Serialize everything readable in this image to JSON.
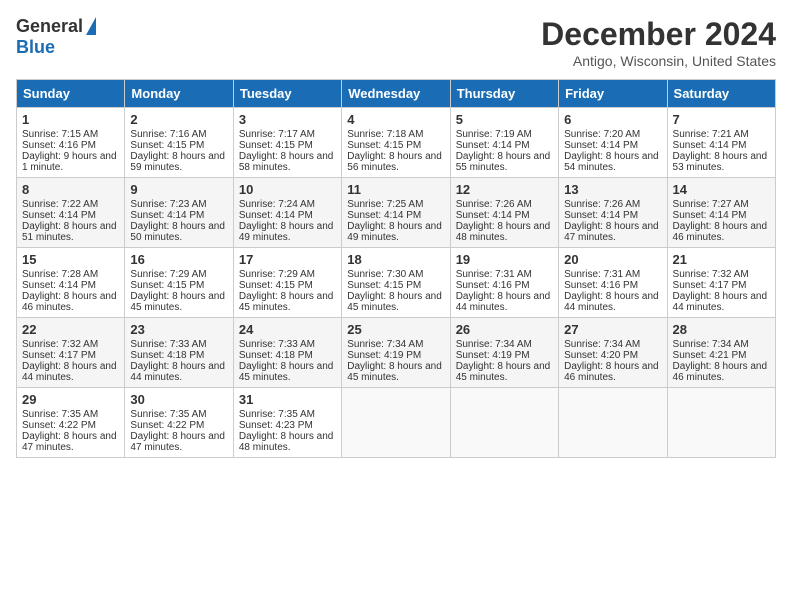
{
  "header": {
    "logo_general": "General",
    "logo_blue": "Blue",
    "month_title": "December 2024",
    "location": "Antigo, Wisconsin, United States"
  },
  "weekdays": [
    "Sunday",
    "Monday",
    "Tuesday",
    "Wednesday",
    "Thursday",
    "Friday",
    "Saturday"
  ],
  "weeks": [
    [
      {
        "day": "1",
        "sunrise": "Sunrise: 7:15 AM",
        "sunset": "Sunset: 4:16 PM",
        "daylight": "Daylight: 9 hours and 1 minute."
      },
      {
        "day": "2",
        "sunrise": "Sunrise: 7:16 AM",
        "sunset": "Sunset: 4:15 PM",
        "daylight": "Daylight: 8 hours and 59 minutes."
      },
      {
        "day": "3",
        "sunrise": "Sunrise: 7:17 AM",
        "sunset": "Sunset: 4:15 PM",
        "daylight": "Daylight: 8 hours and 58 minutes."
      },
      {
        "day": "4",
        "sunrise": "Sunrise: 7:18 AM",
        "sunset": "Sunset: 4:15 PM",
        "daylight": "Daylight: 8 hours and 56 minutes."
      },
      {
        "day": "5",
        "sunrise": "Sunrise: 7:19 AM",
        "sunset": "Sunset: 4:14 PM",
        "daylight": "Daylight: 8 hours and 55 minutes."
      },
      {
        "day": "6",
        "sunrise": "Sunrise: 7:20 AM",
        "sunset": "Sunset: 4:14 PM",
        "daylight": "Daylight: 8 hours and 54 minutes."
      },
      {
        "day": "7",
        "sunrise": "Sunrise: 7:21 AM",
        "sunset": "Sunset: 4:14 PM",
        "daylight": "Daylight: 8 hours and 53 minutes."
      }
    ],
    [
      {
        "day": "8",
        "sunrise": "Sunrise: 7:22 AM",
        "sunset": "Sunset: 4:14 PM",
        "daylight": "Daylight: 8 hours and 51 minutes."
      },
      {
        "day": "9",
        "sunrise": "Sunrise: 7:23 AM",
        "sunset": "Sunset: 4:14 PM",
        "daylight": "Daylight: 8 hours and 50 minutes."
      },
      {
        "day": "10",
        "sunrise": "Sunrise: 7:24 AM",
        "sunset": "Sunset: 4:14 PM",
        "daylight": "Daylight: 8 hours and 49 minutes."
      },
      {
        "day": "11",
        "sunrise": "Sunrise: 7:25 AM",
        "sunset": "Sunset: 4:14 PM",
        "daylight": "Daylight: 8 hours and 49 minutes."
      },
      {
        "day": "12",
        "sunrise": "Sunrise: 7:26 AM",
        "sunset": "Sunset: 4:14 PM",
        "daylight": "Daylight: 8 hours and 48 minutes."
      },
      {
        "day": "13",
        "sunrise": "Sunrise: 7:26 AM",
        "sunset": "Sunset: 4:14 PM",
        "daylight": "Daylight: 8 hours and 47 minutes."
      },
      {
        "day": "14",
        "sunrise": "Sunrise: 7:27 AM",
        "sunset": "Sunset: 4:14 PM",
        "daylight": "Daylight: 8 hours and 46 minutes."
      }
    ],
    [
      {
        "day": "15",
        "sunrise": "Sunrise: 7:28 AM",
        "sunset": "Sunset: 4:14 PM",
        "daylight": "Daylight: 8 hours and 46 minutes."
      },
      {
        "day": "16",
        "sunrise": "Sunrise: 7:29 AM",
        "sunset": "Sunset: 4:15 PM",
        "daylight": "Daylight: 8 hours and 45 minutes."
      },
      {
        "day": "17",
        "sunrise": "Sunrise: 7:29 AM",
        "sunset": "Sunset: 4:15 PM",
        "daylight": "Daylight: 8 hours and 45 minutes."
      },
      {
        "day": "18",
        "sunrise": "Sunrise: 7:30 AM",
        "sunset": "Sunset: 4:15 PM",
        "daylight": "Daylight: 8 hours and 45 minutes."
      },
      {
        "day": "19",
        "sunrise": "Sunrise: 7:31 AM",
        "sunset": "Sunset: 4:16 PM",
        "daylight": "Daylight: 8 hours and 44 minutes."
      },
      {
        "day": "20",
        "sunrise": "Sunrise: 7:31 AM",
        "sunset": "Sunset: 4:16 PM",
        "daylight": "Daylight: 8 hours and 44 minutes."
      },
      {
        "day": "21",
        "sunrise": "Sunrise: 7:32 AM",
        "sunset": "Sunset: 4:17 PM",
        "daylight": "Daylight: 8 hours and 44 minutes."
      }
    ],
    [
      {
        "day": "22",
        "sunrise": "Sunrise: 7:32 AM",
        "sunset": "Sunset: 4:17 PM",
        "daylight": "Daylight: 8 hours and 44 minutes."
      },
      {
        "day": "23",
        "sunrise": "Sunrise: 7:33 AM",
        "sunset": "Sunset: 4:18 PM",
        "daylight": "Daylight: 8 hours and 44 minutes."
      },
      {
        "day": "24",
        "sunrise": "Sunrise: 7:33 AM",
        "sunset": "Sunset: 4:18 PM",
        "daylight": "Daylight: 8 hours and 45 minutes."
      },
      {
        "day": "25",
        "sunrise": "Sunrise: 7:34 AM",
        "sunset": "Sunset: 4:19 PM",
        "daylight": "Daylight: 8 hours and 45 minutes."
      },
      {
        "day": "26",
        "sunrise": "Sunrise: 7:34 AM",
        "sunset": "Sunset: 4:19 PM",
        "daylight": "Daylight: 8 hours and 45 minutes."
      },
      {
        "day": "27",
        "sunrise": "Sunrise: 7:34 AM",
        "sunset": "Sunset: 4:20 PM",
        "daylight": "Daylight: 8 hours and 46 minutes."
      },
      {
        "day": "28",
        "sunrise": "Sunrise: 7:34 AM",
        "sunset": "Sunset: 4:21 PM",
        "daylight": "Daylight: 8 hours and 46 minutes."
      }
    ],
    [
      {
        "day": "29",
        "sunrise": "Sunrise: 7:35 AM",
        "sunset": "Sunset: 4:22 PM",
        "daylight": "Daylight: 8 hours and 47 minutes."
      },
      {
        "day": "30",
        "sunrise": "Sunrise: 7:35 AM",
        "sunset": "Sunset: 4:22 PM",
        "daylight": "Daylight: 8 hours and 47 minutes."
      },
      {
        "day": "31",
        "sunrise": "Sunrise: 7:35 AM",
        "sunset": "Sunset: 4:23 PM",
        "daylight": "Daylight: 8 hours and 48 minutes."
      },
      null,
      null,
      null,
      null
    ]
  ]
}
